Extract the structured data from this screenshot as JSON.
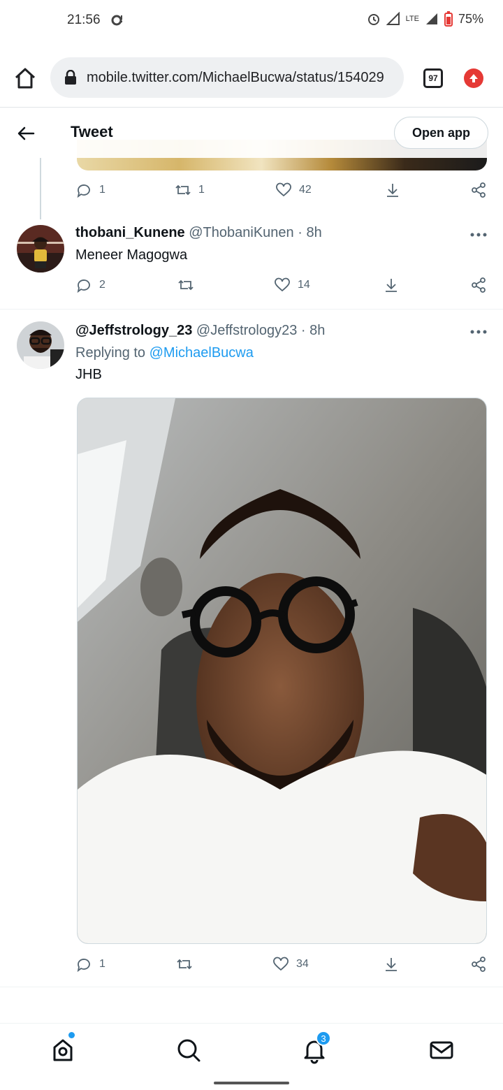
{
  "status_bar": {
    "time": "21:56",
    "battery": "75%",
    "network": "LTE"
  },
  "browser": {
    "url": "mobile.twitter.com/MichaelBucwa/status/154029",
    "tab_count": "97"
  },
  "header": {
    "title": "Tweet",
    "open_app_label": "Open app"
  },
  "prev_tweet_actions": {
    "replies": "1",
    "retweets": "1",
    "likes": "42"
  },
  "tweets": [
    {
      "name": "thobani_Kunene",
      "handle": "@ThobaniKunen",
      "time": "8h",
      "text": "Meneer Magogwa",
      "replies": "2",
      "retweets": "",
      "likes": "14"
    },
    {
      "name": "@Jeffstrology_23",
      "handle": "@Jeffstrology23",
      "time": "8h",
      "replying_label": "Replying to",
      "replying_to": "@MichaelBucwa",
      "text": "JHB",
      "replies": "1",
      "retweets": "",
      "likes": "34"
    }
  ],
  "nav": {
    "notifications_badge": "3"
  },
  "colors": {
    "accent": "#1d9bf0",
    "text": "#0f1419",
    "muted": "#536471"
  }
}
